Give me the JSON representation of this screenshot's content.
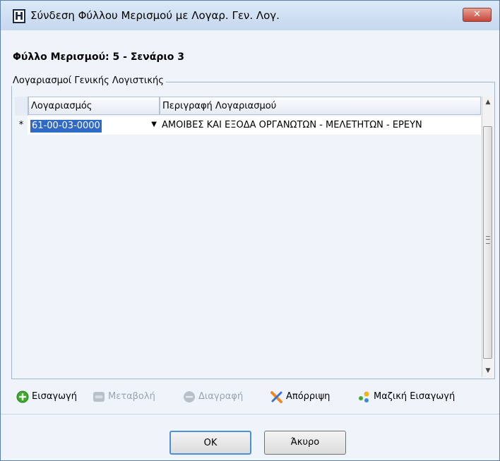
{
  "window": {
    "title": "Σύνδεση Φύλλου Μερισμού με Λογαρ. Γεν. Λογ.",
    "app_icon_letter": "H",
    "close_glyph": "✕"
  },
  "heading": "Φύλλο Μερισμού: 5 - Σενάριο 3",
  "group": {
    "label": "Λογαριασμοί Γενικής Λογιστικής"
  },
  "grid": {
    "columns": [
      "Λογαριασμός",
      "Περιγραφή Λογαριασμού"
    ],
    "rows": [
      {
        "indicator": "*",
        "account": "61-00-03-0000",
        "description": "ΑΜΟΙΒΕΣ ΚΑΙ ΕΞΟΔΑ ΟΡΓΑΝΩΤΩΝ - ΜΕΛΕΤΗΤΩΝ - ΕΡΕΥΝ"
      }
    ]
  },
  "toolbar": {
    "insert": "Εισαγωγή",
    "modify": "Μεταβολή",
    "delete": "Διαγραφή",
    "discard": "Απόρριψη",
    "bulk_insert": "Μαζική Εισαγωγή"
  },
  "buttons": {
    "ok": "OK",
    "cancel": "Άκυρο"
  },
  "icons": {
    "insert": "plus-circle-icon",
    "modify": "edit-icon",
    "delete": "minus-circle-icon",
    "discard": "x-icon",
    "bulk_insert": "bulk-insert-icon"
  },
  "colors": {
    "selection": "#316ac5",
    "close_button": "#c7453a",
    "insert_icon": "#3cac2b",
    "discard_icon": "#f08a1c"
  }
}
